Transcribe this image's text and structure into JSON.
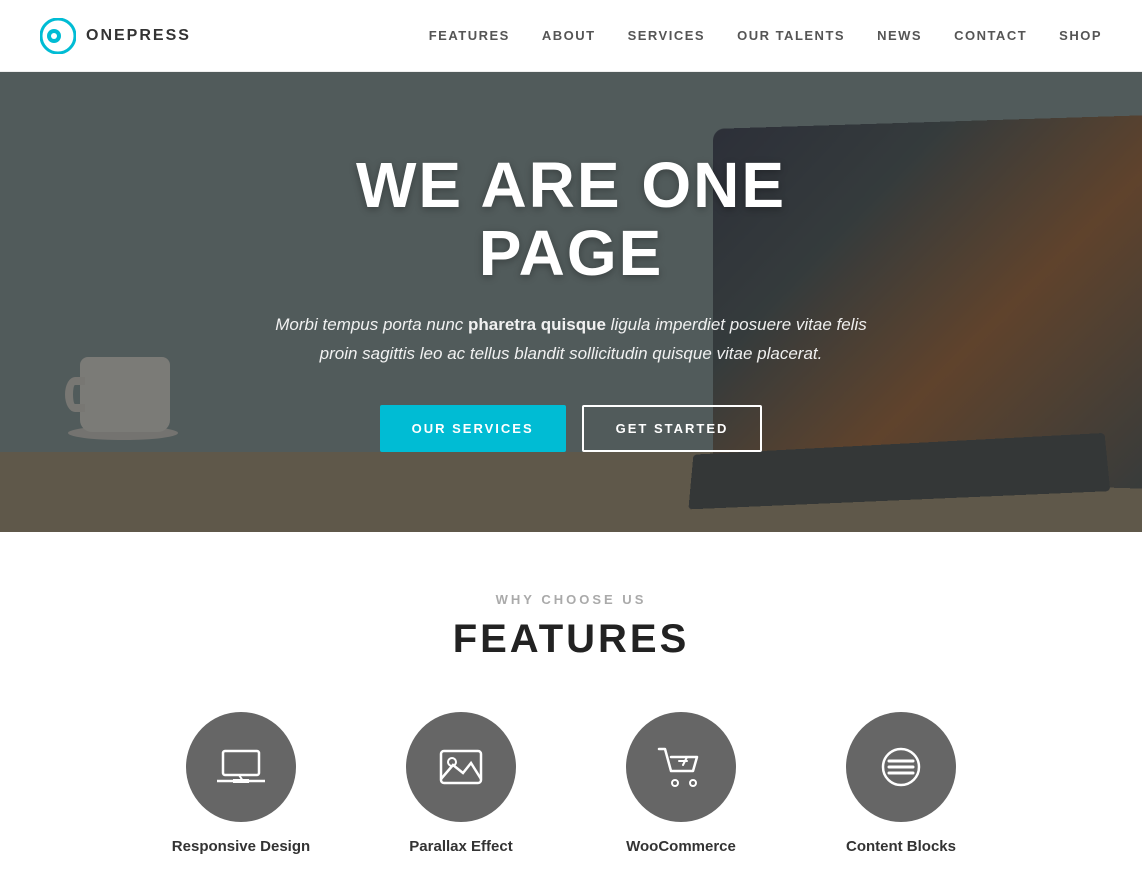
{
  "header": {
    "logo_text": "ONEPRESS",
    "nav_items": [
      {
        "label": "FEATURES",
        "id": "nav-features"
      },
      {
        "label": "ABOUT",
        "id": "nav-about"
      },
      {
        "label": "SERVICES",
        "id": "nav-services"
      },
      {
        "label": "OUR TALENTS",
        "id": "nav-talents"
      },
      {
        "label": "NEWS",
        "id": "nav-news"
      },
      {
        "label": "CONTACT",
        "id": "nav-contact"
      },
      {
        "label": "SHOP",
        "id": "nav-shop"
      }
    ]
  },
  "hero": {
    "title": "WE ARE ONE PAGE",
    "subtitle_plain": "Morbi tempus porta nunc ",
    "subtitle_bold": "pharetra quisque",
    "subtitle_rest": " ligula imperdiet posuere vitae felis proin sagittis leo ac tellus blandit sollicitudin quisque vitae placerat.",
    "btn_primary": "OUR SERVICES",
    "btn_secondary": "GET STARTED"
  },
  "features": {
    "section_subtitle": "WHY CHOOSE US",
    "section_title": "FEATURES",
    "items": [
      {
        "label": "Responsive Design",
        "icon": "laptop"
      },
      {
        "label": "Parallax Effect",
        "icon": "image"
      },
      {
        "label": "WooCommerce",
        "icon": "cart"
      },
      {
        "label": "Content Blocks",
        "icon": "lines"
      }
    ]
  }
}
